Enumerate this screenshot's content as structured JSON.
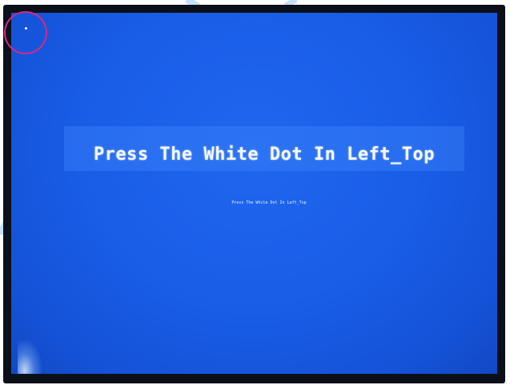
{
  "screen": {
    "title": "Press The White Dot In Left_Top",
    "subtitle": "Press The White Dot In Left_Top",
    "background_color": "#1a5ee8",
    "text_color": "#f4f8ff",
    "target_ring_color": "#d32a86"
  },
  "target": {
    "icon": "white-dot-icon"
  }
}
